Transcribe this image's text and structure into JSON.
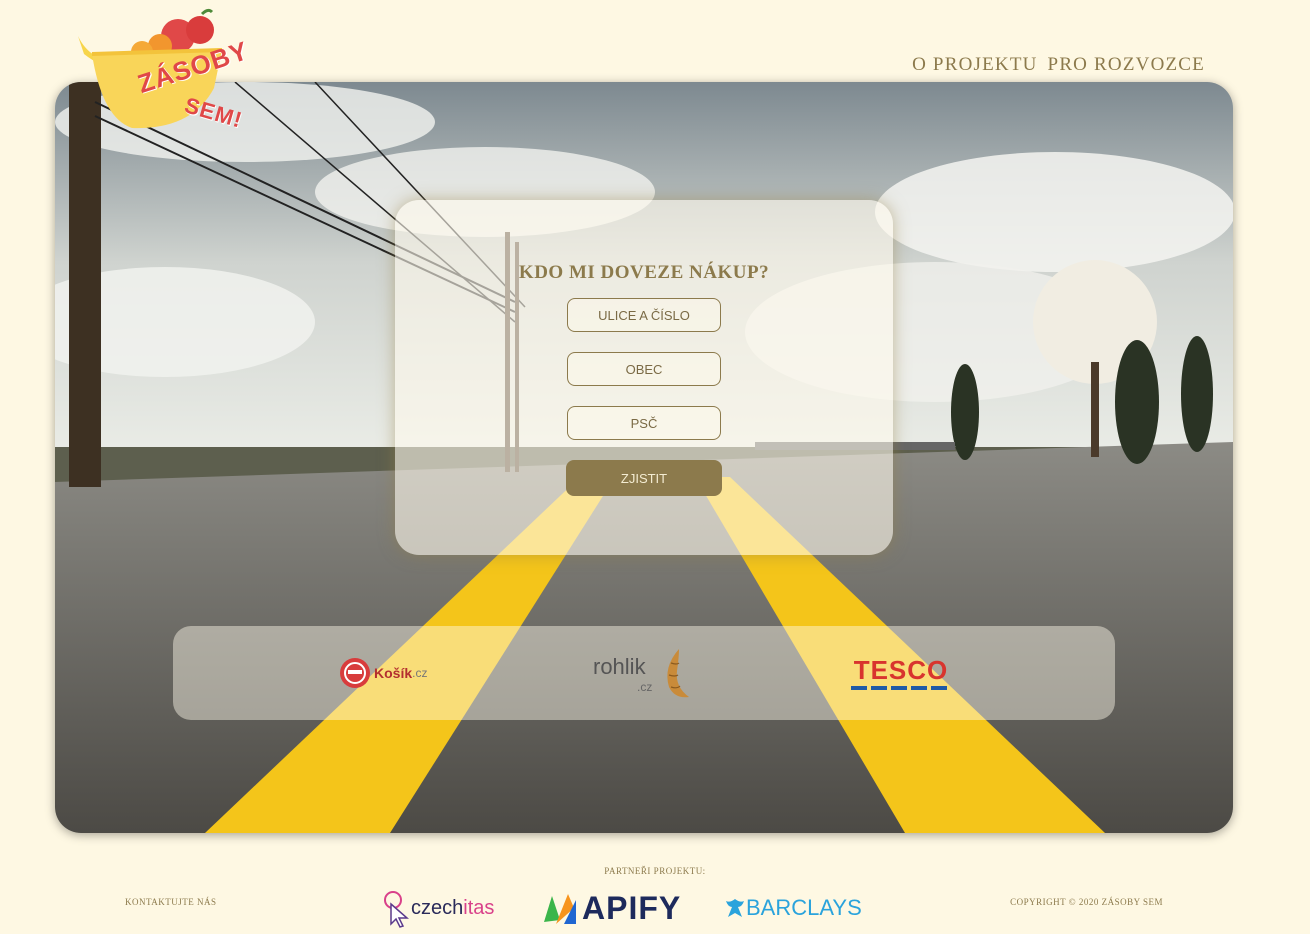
{
  "brand": {
    "line1": "ZÁSOBY",
    "line2": "SEM!"
  },
  "nav": [
    {
      "label": "O PROJEKTU"
    },
    {
      "label": "PRO ROZVOZCE"
    }
  ],
  "form": {
    "title": "KDO MI DOVEZE NÁKUP?",
    "street_placeholder": "ULICE A ČÍSLO",
    "city_placeholder": "OBEC",
    "zip_placeholder": "PSČ",
    "submit_label": "ZJISTIT"
  },
  "shops": [
    {
      "name": "Košík",
      "suffix": ".cz"
    },
    {
      "name": "rohlik",
      "suffix": ".cz"
    },
    {
      "name": "TESCO"
    }
  ],
  "footer": {
    "partners_label": "PARTNEŘI PROJEKTU:",
    "contact": "KONTAKTUJTE NÁS",
    "copyright": "COPYRIGHT © 2020 ZÁSOBY SEM",
    "partners": [
      {
        "name": "czech",
        "accent": "itas"
      },
      {
        "name": "APIFY"
      },
      {
        "name": "BARCLAYS"
      }
    ]
  },
  "colors": {
    "background": "#fef8e3",
    "accent": "#8c7a4c",
    "brand_red": "#e04848",
    "road_yellow": "#f4c51a"
  },
  "icons": [
    "fruit-basket-logo",
    "kosik-cart-icon",
    "croissant-icon",
    "czechitas-cursor-icon",
    "apify-logo-icon",
    "barclays-eagle-icon"
  ]
}
